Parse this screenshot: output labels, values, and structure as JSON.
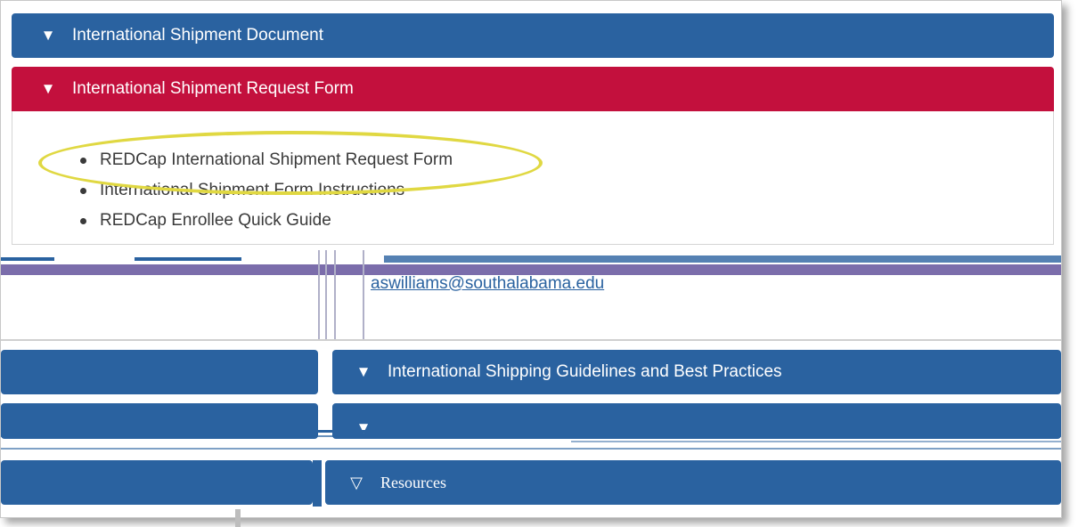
{
  "accordion": {
    "shipment_document": {
      "toggle_icon": "▼",
      "title": "International Shipment Document"
    },
    "request_form": {
      "toggle_icon": "▼",
      "title": "International Shipment Request Form",
      "links": [
        "REDCap International Shipment Request Form",
        "International Shipment Form Instructions",
        "REDCap Enrollee Quick Guide"
      ],
      "contact_email": "aswilliams@southalabama.edu"
    },
    "shipping_guidelines": {
      "toggle_icon": "▼",
      "title": "International Shipping Guidelines and Best Practices"
    },
    "additional": {
      "toggle_icon": "▼"
    },
    "resources": {
      "toggle_icon": "▽",
      "title": "Resources"
    }
  },
  "colors": {
    "header_blue": "#2a62a0",
    "header_red": "#c3103d",
    "highlight_ring": "#e0d842"
  },
  "icons": {
    "toggle": "triangle-down-icon",
    "bullet": "bullet-icon"
  }
}
